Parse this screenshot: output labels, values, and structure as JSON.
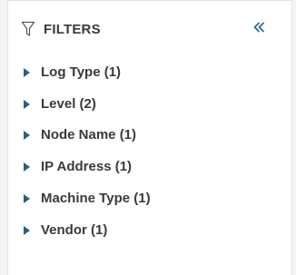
{
  "filters_panel": {
    "title": "FILTERS",
    "icons": {
      "filter": "filter-funnel-icon",
      "collapse": "double-chevron-left-icon"
    },
    "accent_color": "#2f6a8c",
    "items": [
      {
        "label": "Log Type (1)"
      },
      {
        "label": "Level (2)"
      },
      {
        "label": "Node Name (1)"
      },
      {
        "label": "IP Address (1)"
      },
      {
        "label": "Machine Type (1)"
      },
      {
        "label": "Vendor (1)"
      }
    ]
  }
}
